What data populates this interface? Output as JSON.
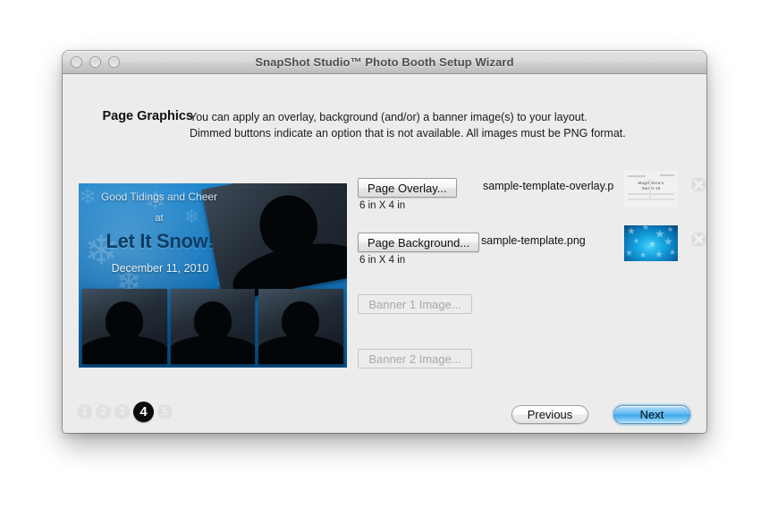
{
  "window": {
    "title": "SnapShot Studio™ Photo Booth Setup Wizard",
    "traffic_lights": [
      "close",
      "minimize",
      "zoom"
    ]
  },
  "header": {
    "section_title": "Page Graphics",
    "line1": "You can apply an overlay, background (and/or) a banner image(s) to your layout.",
    "line2": "Dimmed buttons indicate an option that is not available. All images must be PNG format."
  },
  "preview": {
    "greeting": "Good Tidings and Cheer",
    "at": "at",
    "event_name": "Let It Snow!",
    "date": "December 11, 2010",
    "background_color": "#1576bb",
    "title_color": "#0c3d66"
  },
  "rows": [
    {
      "button_label": "Page Overlay...",
      "dimensions": "6 in X 4 in",
      "filename": "sample-template-overlay.p",
      "enabled": true,
      "thumbnail": "overlay-thumbnail",
      "thumb_text_1": "Magdalena's",
      "thumb_text_2": "Sweet 16",
      "remove_label": "Remove"
    },
    {
      "button_label": "Page Background...",
      "dimensions": "6 in X 4 in",
      "filename": "sample-template.png",
      "enabled": true,
      "thumbnail": "background-thumbnail",
      "remove_label": "Remove"
    },
    {
      "button_label": "Banner 1 Image...",
      "dimensions": "",
      "filename": "",
      "enabled": false,
      "thumbnail": "",
      "remove_label": ""
    },
    {
      "button_label": "Banner 2 Image...",
      "dimensions": "",
      "filename": "",
      "enabled": false,
      "thumbnail": "",
      "remove_label": ""
    }
  ],
  "steps": {
    "items": [
      "1",
      "2",
      "3",
      "4",
      "5"
    ],
    "active": "4"
  },
  "footer": {
    "previous_label": "Previous",
    "next_label": "Next",
    "next_is_default": true,
    "accent_color": "#3aa6ec"
  }
}
